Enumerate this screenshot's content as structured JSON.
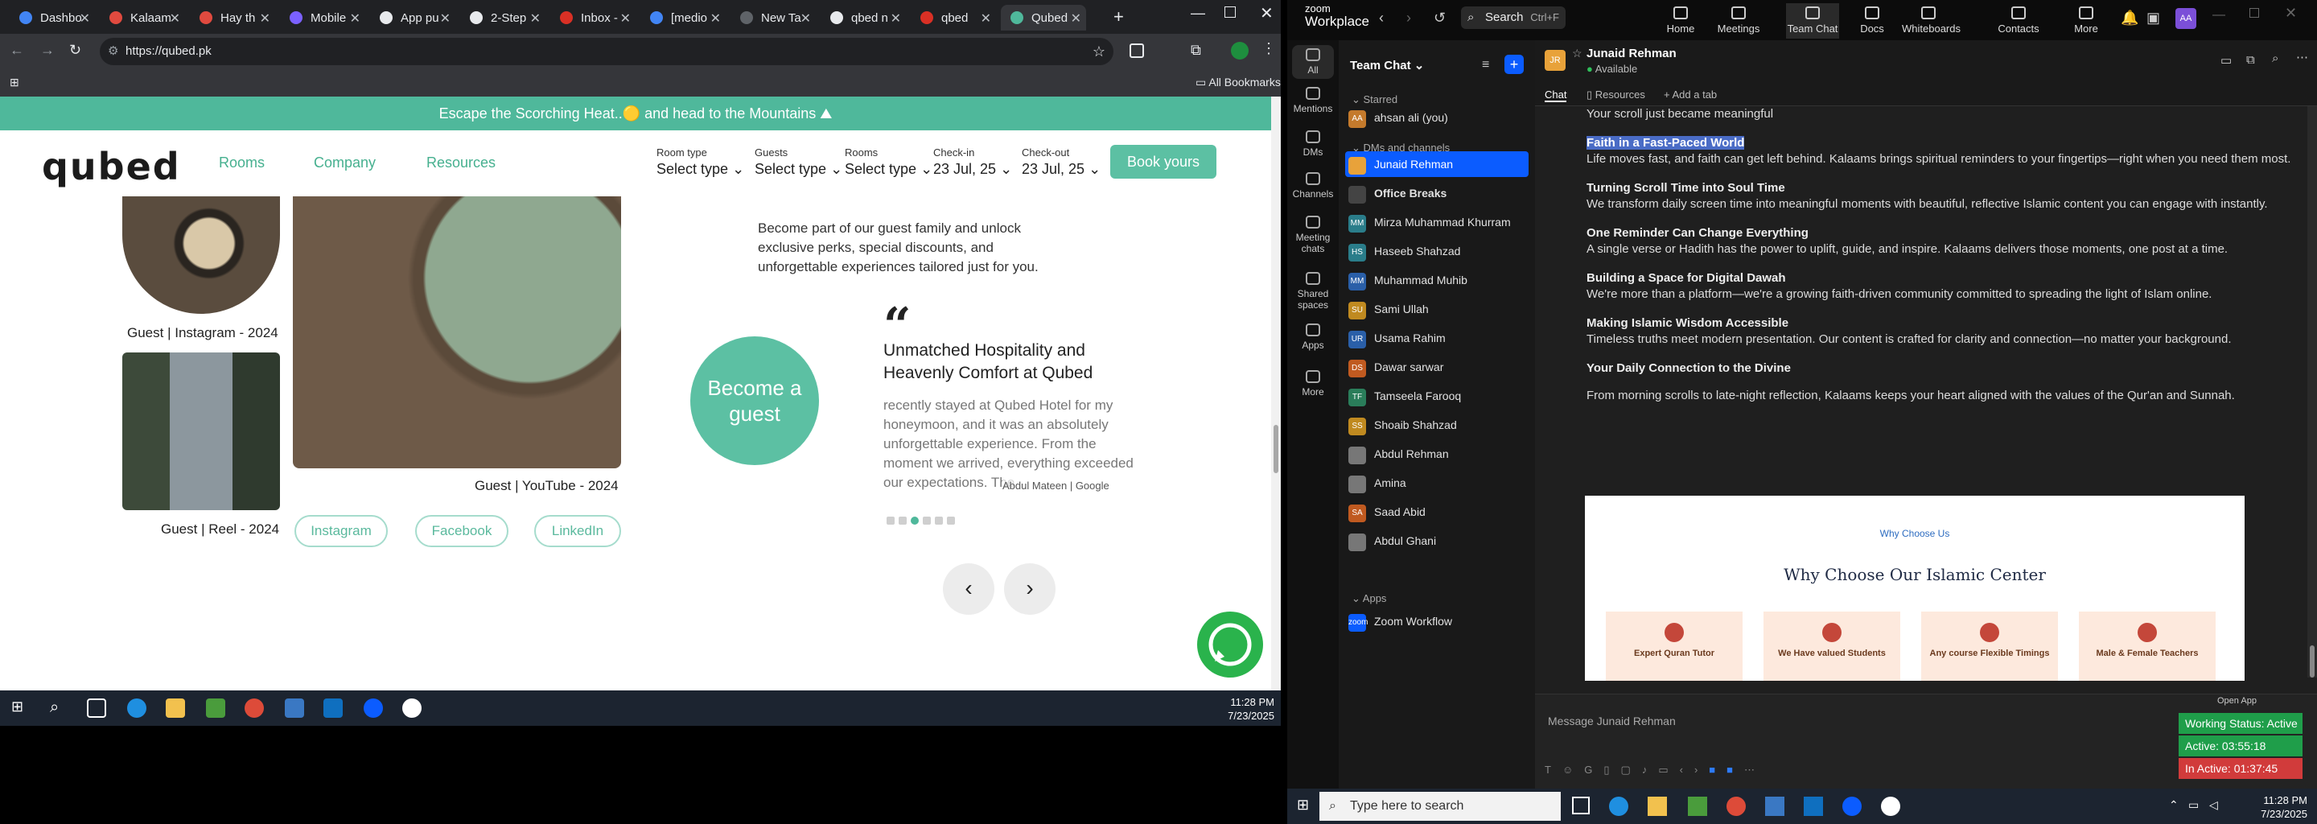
{
  "browser": {
    "tabs": [
      {
        "label": "Dashbo",
        "color": "#4285f4"
      },
      {
        "label": "Kalaam",
        "color": "#e04a3f"
      },
      {
        "label": "Hay th",
        "color": "#e04a3f"
      },
      {
        "label": "Mobile",
        "color": "#7b61ff"
      },
      {
        "label": "App pu",
        "color": "#e8eaed"
      },
      {
        "label": "2-Step",
        "color": "#e8eaed"
      },
      {
        "label": "Inbox -",
        "color": "#d93025"
      },
      {
        "label": "[medio",
        "color": "#4285f4"
      },
      {
        "label": "New Ta",
        "color": "#5f6368"
      },
      {
        "label": "qbed n",
        "color": "#e8eaed"
      },
      {
        "label": "qbed",
        "color": "#d93025"
      },
      {
        "label": "Qubed",
        "color": "#4fb89b"
      }
    ],
    "url": "https://qubed.pk",
    "all_bookmarks": "All Bookmarks"
  },
  "site": {
    "promo": "Escape the Scorching Heat..🟡 and head to the Mountains ⛰",
    "logo": "qubed",
    "nav": [
      "Rooms",
      "Company",
      "Resources"
    ],
    "booking": [
      {
        "label": "Room type",
        "value": "Select type"
      },
      {
        "label": "Guests",
        "value": "Select type"
      },
      {
        "label": "Rooms",
        "value": "Select type"
      },
      {
        "label": "Check-in",
        "value": "23 Jul, 25"
      },
      {
        "label": "Check-out",
        "value": "23 Jul, 25"
      }
    ],
    "book_button": "Book yours",
    "captions": {
      "instagram": "Guest | Instagram - 2024",
      "reel": "Guest | Reel - 2024",
      "youtube": "Guest | YouTube - 2024"
    },
    "socials": [
      "Instagram",
      "Facebook",
      "LinkedIn"
    ],
    "join_text": "Become part of our guest family and unlock exclusive perks, special discounts, and unforgettable experiences tailored just for you.",
    "become_guest": "Become a guest",
    "review": {
      "quote_mark": "“",
      "title": "Unmatched Hospitality and Heavenly Comfort at Qubed",
      "body": "recently stayed at Qubed Hotel for my honeymoon, and it was an absolutely unforgettable experience. From the moment we arrived, everything exceeded our expectations. The",
      "author": "Abdul Mateen | Google"
    },
    "arrows": {
      "prev": "‹",
      "next": "›"
    }
  },
  "taskbar_left": {
    "time": "11:28 PM",
    "date": "7/23/2025"
  },
  "zoom": {
    "brand_top": "zoom",
    "brand_bottom": "Workplace",
    "search": "Search",
    "search_shortcut": "Ctrl+F",
    "top_nav": [
      "Home",
      "Meetings",
      "Team Chat",
      "Docs",
      "Whiteboards",
      "Contacts",
      "More"
    ],
    "rail": [
      "All",
      "Mentions",
      "DMs",
      "Channels",
      "Meeting chats",
      "Shared spaces",
      "Apps",
      "More"
    ],
    "sidebar_title": "Team Chat",
    "starred_header": "Starred",
    "starred": [
      {
        "name": "ahsan ali (you)",
        "initials": "AA",
        "color": "#c47a2c"
      }
    ],
    "dms_header": "DMs and channels",
    "dms": [
      {
        "name": "Junaid Rehman",
        "initials": "",
        "color": "#e8a23a",
        "active": true
      },
      {
        "name": "Office Breaks",
        "initials": "",
        "color": "#444"
      },
      {
        "name": "Mirza Muhammad Khurram",
        "initials": "MM",
        "color": "#2a7d8a"
      },
      {
        "name": "Haseeb Shahzad",
        "initials": "HS",
        "color": "#2a7d8a"
      },
      {
        "name": "Muhammad Muhib",
        "initials": "MM",
        "color": "#2a5fa8"
      },
      {
        "name": "Sami Ullah",
        "initials": "SU",
        "color": "#c08a20"
      },
      {
        "name": "Usama Rahim",
        "initials": "UR",
        "color": "#2a5fa8"
      },
      {
        "name": "Dawar sarwar",
        "initials": "DS",
        "color": "#c05a20"
      },
      {
        "name": "Tamseela Farooq",
        "initials": "TF",
        "color": "#2a7d5a"
      },
      {
        "name": "Shoaib Shahzad",
        "initials": "SS",
        "color": "#c08a20"
      },
      {
        "name": "Abdul Rehman",
        "initials": "",
        "color": "#777"
      },
      {
        "name": "Amina",
        "initials": "",
        "color": "#777"
      },
      {
        "name": "Saad Abid",
        "initials": "SA",
        "color": "#c05a20"
      },
      {
        "name": "Abdul Ghani",
        "initials": "",
        "color": "#777"
      }
    ],
    "apps_header": "Apps",
    "apps": [
      {
        "name": "Zoom Workflow",
        "initials": "zoom",
        "color": "#0b5cff"
      }
    ],
    "chat": {
      "header_initials": "JR",
      "header_name": "Junaid Rehman",
      "header_status": "Available",
      "tabs": [
        "Chat",
        "Resources",
        "Add a tab"
      ],
      "intro": "Your scroll just became meaningful",
      "sections": [
        {
          "heading": "Faith in a Fast-Paced World",
          "text": "Life moves fast, and faith can get left behind. Kalaams brings spiritual reminders to your fingertips—right when you need them most.",
          "highlight": true
        },
        {
          "heading": "Turning Scroll Time into Soul Time",
          "text": "We transform daily screen time into meaningful moments with beautiful, reflective Islamic content you can engage with instantly."
        },
        {
          "heading": "One Reminder Can Change Everything",
          "text": "A single verse or Hadith has the power to uplift, guide, and inspire. Kalaams delivers those moments, one post at a time."
        },
        {
          "heading": "Building a Space for Digital Dawah",
          "text": "We're more than a platform—we're a growing faith-driven community committed to spreading the light of Islam online."
        },
        {
          "heading": "Making Islamic Wisdom Accessible",
          "text": "Timeless truths meet modern presentation. Our content is crafted for clarity and connection—no matter your background."
        },
        {
          "heading": "Your Daily Connection to the Divine",
          "text": "From morning scrolls to late-night reflection, Kalaams keeps your heart aligned with the values of the Qur'an and Sunnah."
        }
      ],
      "banner": {
        "eyebrow": "Why Choose Us",
        "title": "Why Choose Our Islamic Center",
        "features": [
          "Expert Quran Tutor",
          "We Have valued Students",
          "Any course Flexible Timings",
          "Male & Female Teachers"
        ]
      },
      "placeholder": "Message Junaid Rehman",
      "open_app": "Open App"
    },
    "status_panel": {
      "working": "Working Status: Active",
      "active": "Active: 03:55:18",
      "inactive": "In Active: 01:37:45"
    }
  },
  "taskbar_right": {
    "search": "Type here to search",
    "time": "11:28 PM",
    "date": "7/23/2025"
  }
}
